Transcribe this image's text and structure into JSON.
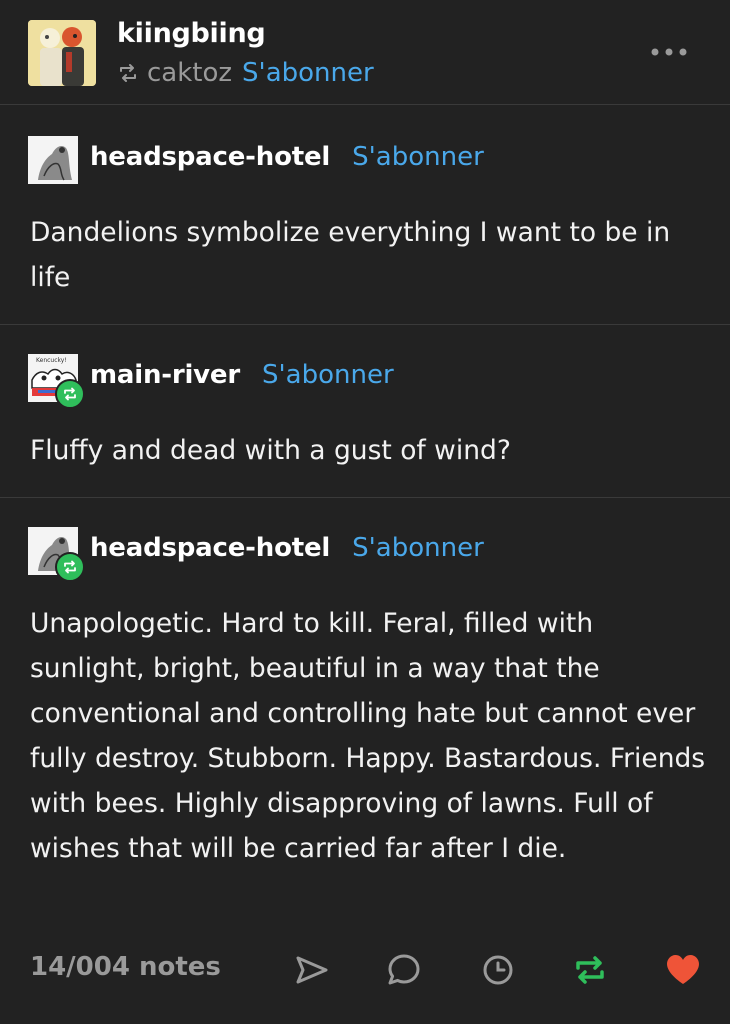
{
  "header": {
    "blog_name": "kiingbiing",
    "reblogged_from": "caktoz",
    "follow_label": "S'abonner"
  },
  "thread": [
    {
      "author": "headspace-hotel",
      "follow_label": "S'abonner",
      "text": "Dandelions symbolize everything I want to be in life"
    },
    {
      "author": "main-river",
      "follow_label": "S'abonner",
      "avatar_caption": "Kencucky!",
      "text": "Fluffy and dead with a gust of wind?"
    },
    {
      "author": "headspace-hotel",
      "follow_label": "S'abonner",
      "text": "Unapologetic. Hard to kill. Feral, filled with sunlight, bright, beautiful in a way that the conventional and controlling hate but cannot ever fully destroy. Stubborn. Happy. Bastardous. Friends with bees. Highly disapproving of lawns. Full of wishes that will be carried far after I die."
    }
  ],
  "footer": {
    "notes": "14/004 notes",
    "icons": [
      "share-icon",
      "reply-icon",
      "schedule-icon",
      "reblog-icon",
      "like-icon"
    ]
  },
  "colors": {
    "background": "#222222",
    "link": "#4aa8ea",
    "reblog_green": "#2fbe5b",
    "like_red": "#ef5438",
    "muted": "#9a9a9a"
  }
}
